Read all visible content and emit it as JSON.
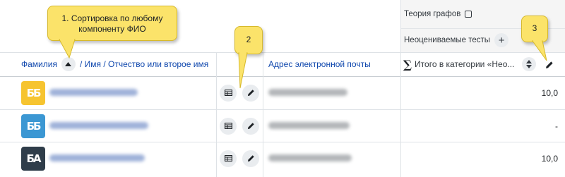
{
  "category": {
    "theory_label": "Теория графов",
    "ungraded_label": "Неоцениваемые тесты",
    "add_symbol": "+"
  },
  "header": {
    "surname": "Фамилия",
    "name_part": "/ Имя / Отчество или второе имя",
    "email": "Адрес электронной почты",
    "total": "Итого в категории «Нео...",
    "sigma": "∑"
  },
  "rows": [
    {
      "value": "10,0",
      "avatar_color": "#f6c430",
      "avatar_text": "ББ"
    },
    {
      "value": "-",
      "avatar_color": "#3b97d3",
      "avatar_text": "ББ"
    },
    {
      "value": "10,0",
      "avatar_color": "#2f3d4a",
      "avatar_text": "БА"
    }
  ],
  "callouts": {
    "one": "1. Сортировка по любому компоненту ФИО",
    "two": "2",
    "three": "3"
  },
  "icons": {
    "sort": "sort-ascending-icon",
    "edit": "pencil-icon",
    "grid": "table-grid-icon",
    "collapse": "checkbox-icon",
    "add": "plus-icon",
    "sum": "sigma-icon"
  }
}
